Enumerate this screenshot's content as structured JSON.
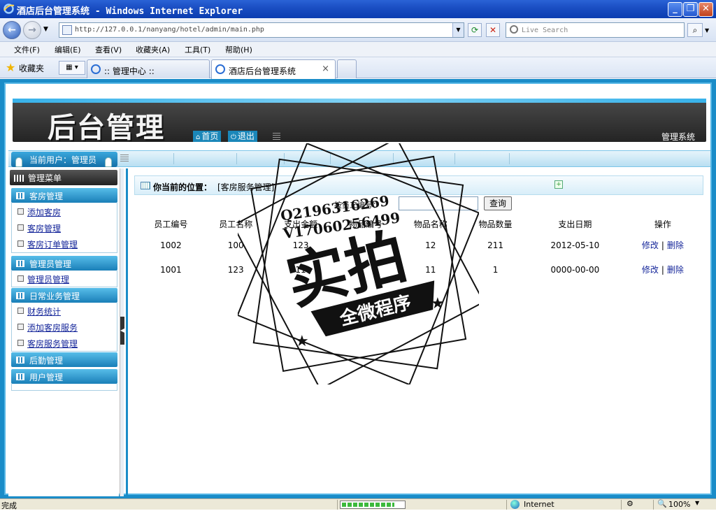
{
  "window": {
    "title": "酒店后台管理系统 - Windows Internet Explorer",
    "address": "http://127.0.0.1/nanyang/hotel/admin/main.php",
    "search_placeholder": "Live Search",
    "menu": [
      "文件(F)",
      "编辑(E)",
      "查看(V)",
      "收藏夹(A)",
      "工具(T)",
      "帮助(H)"
    ],
    "favorites_label": "收藏夹",
    "tabs": [
      {
        "label": ":: 管理中心 ::"
      },
      {
        "label": "酒店后台管理系统",
        "close": "×"
      }
    ],
    "status_text": "完成",
    "progress": 0.85,
    "zone": "Internet",
    "zoom": "100%"
  },
  "header": {
    "logo": "后台管理",
    "home_label": "首页",
    "logout_label": "退出",
    "system_name": "管理系统"
  },
  "userbar": {
    "label": "当前用户：管理员"
  },
  "sidebar": {
    "title": "管理菜单",
    "sections": [
      {
        "label": "客房管理",
        "items": [
          "添加客房",
          "客房管理",
          "客房订单管理"
        ]
      },
      {
        "label": "管理员管理",
        "items": [
          "管理员管理"
        ]
      },
      {
        "label": "日常业务管理",
        "items": [
          "财务统计",
          "添加客房服务",
          "客房服务管理"
        ]
      },
      {
        "label": "后勤管理",
        "items": []
      },
      {
        "label": "用户管理",
        "items": []
      }
    ]
  },
  "content": {
    "crumb_label": "你当前的位置：",
    "crumb_value": "[客房服务管理]",
    "search_label": "按员工编号：",
    "search_value": "",
    "search_button": "查询",
    "columns": [
      "员工编号",
      "员工名称",
      "支出金额",
      "物品编号",
      "物品名称",
      "物品数量",
      "支出日期",
      "操作"
    ],
    "rows": [
      {
        "cells": [
          "1002",
          "100",
          "123",
          "",
          "12",
          "211",
          "2012-05-10"
        ],
        "edit": "修改",
        "delete": "删除"
      },
      {
        "cells": [
          "1001",
          "123",
          "11",
          "",
          "11",
          "1",
          "0000-00-00"
        ],
        "edit": "修改",
        "delete": "删除"
      }
    ]
  },
  "stamp": {
    "line1": "Q2196316269",
    "line2": "V17060256499",
    "big": "实拍",
    "banner": "全微程序"
  }
}
